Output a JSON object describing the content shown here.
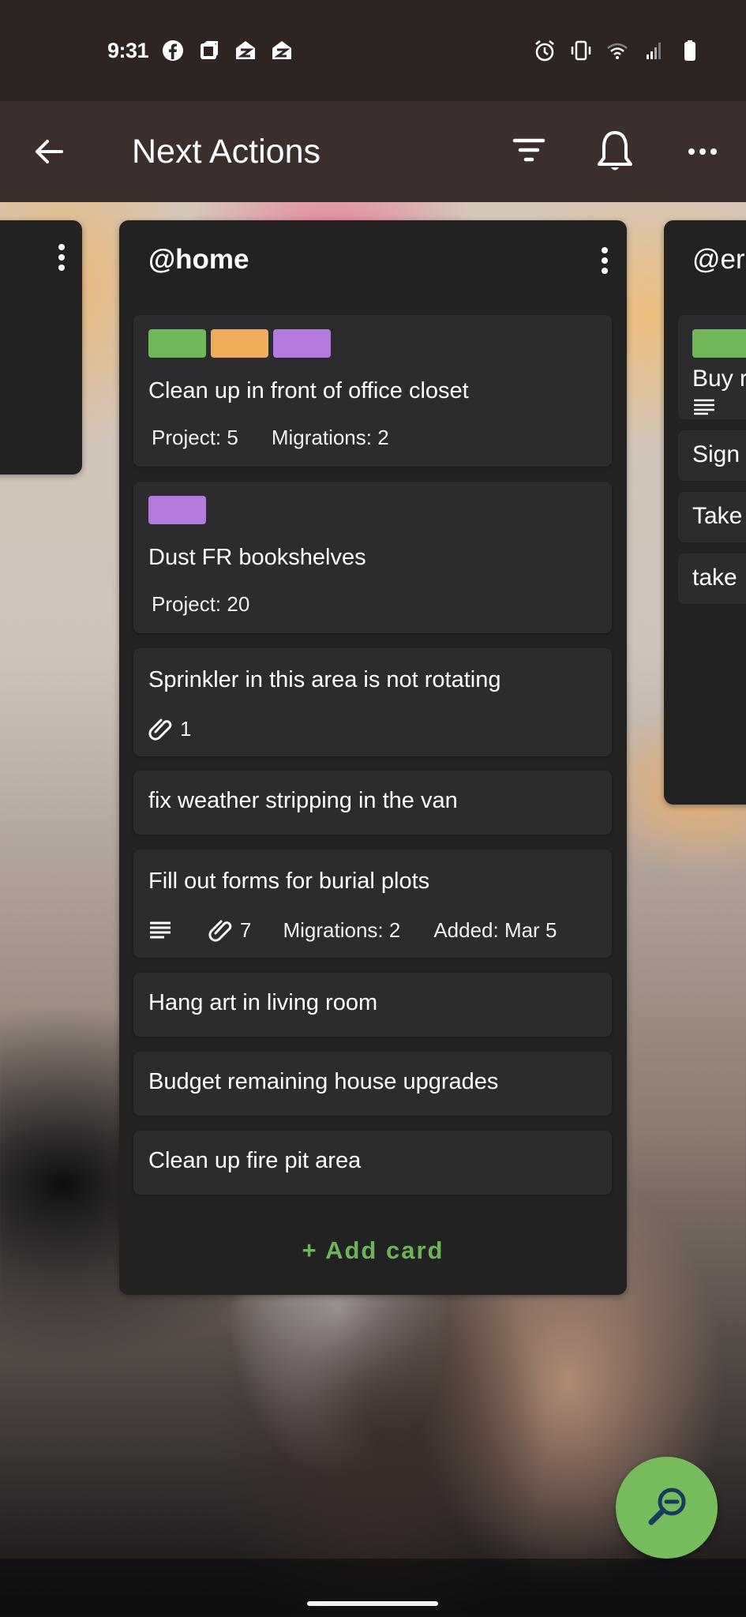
{
  "status_bar": {
    "time": "9:31",
    "left_icons": [
      "facebook-icon",
      "square-app-icon",
      "zillow-icon",
      "zillow-icon"
    ],
    "right_icons": [
      "alarm-icon",
      "vibrate-icon",
      "wifi-icon",
      "signal-icon",
      "battery-icon"
    ]
  },
  "app_bar": {
    "title": "Next Actions",
    "back_icon": "arrow-left-icon",
    "actions": [
      "filter-icon",
      "bell-icon",
      "more-horizontal-icon"
    ]
  },
  "lists": [
    {
      "id": "left-partial",
      "title": "",
      "cards": []
    },
    {
      "id": "home",
      "title": "@home",
      "cards": [
        {
          "title": "Clean up in front of office closet",
          "labels": [
            "#70b85a",
            "#f0ac5a",
            "#b57add"
          ],
          "meta": {
            "project": "Project: 5",
            "migrations": "Migrations: 2"
          }
        },
        {
          "title": "Dust FR bookshelves",
          "labels": [
            "#b57add"
          ],
          "meta": {
            "project": "Project: 20"
          }
        },
        {
          "title": "Sprinkler in this area is not rotating",
          "meta": {
            "attachments": "1"
          }
        },
        {
          "title": "fix weather stripping in the van"
        },
        {
          "title": "Fill out forms for burial plots",
          "meta": {
            "has_description": true,
            "attachments": "7",
            "migrations": "Migrations: 2",
            "added": "Added: Mar 5"
          }
        },
        {
          "title": "Hang art in living room"
        },
        {
          "title": "Budget remaining house upgrades"
        },
        {
          "title": "Clean up fire pit area"
        }
      ],
      "add_card_label": "+ Add card"
    },
    {
      "id": "errands-partial",
      "title": "@er",
      "cards": [
        {
          "title": "Buy r",
          "labels": [
            "#70b85a"
          ],
          "meta": {
            "has_description": true
          }
        },
        {
          "title": "Sign"
        },
        {
          "title": "Take"
        },
        {
          "title": "take"
        }
      ]
    }
  ],
  "fab": {
    "icon": "zoom-out-icon",
    "color": "#76bc5c"
  },
  "colors": {
    "status_bar": "#2e2523",
    "app_bar": "#3b2f2d",
    "list_bg": "#222223",
    "card_bg": "#2c2c2e",
    "accent_green": "#6db35a"
  }
}
